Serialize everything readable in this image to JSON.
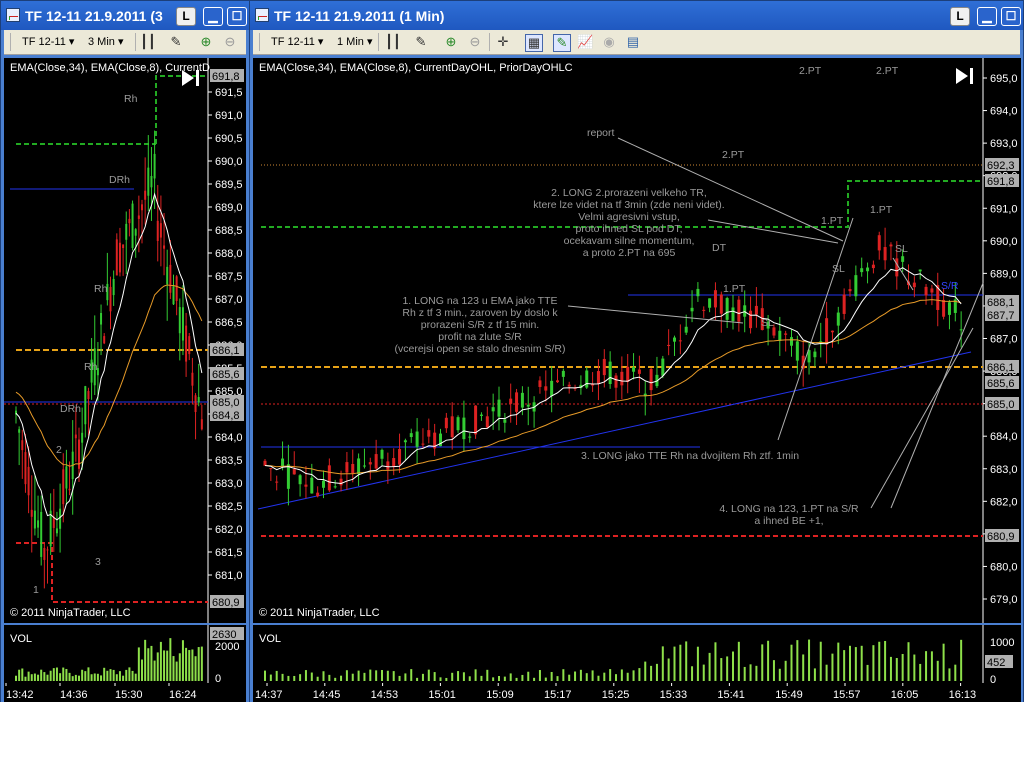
{
  "left_window": {
    "title": "TF 12-11  21.9.2011 (3",
    "indicator_btn": "L",
    "toolbar": {
      "instrument": "TF 12-11",
      "interval": "3 Min"
    },
    "indicators": "EMA(Close,34), EMA(Close,8), CurrentD",
    "copyright": "© 2011 NinjaTrader, LLC",
    "vol_label": "VOL",
    "price_axis": [
      "691,5",
      "691,0",
      "690,5",
      "690,0",
      "689,5",
      "689,0",
      "688,5",
      "688,0",
      "687,5",
      "687,0",
      "686,5",
      "686,0",
      "685,5",
      "685,0",
      "684,5",
      "684,0",
      "683,5",
      "683,0",
      "682,5",
      "682,0",
      "681,5",
      "681,0"
    ],
    "price_tags": [
      {
        "label": "691,8",
        "color": "#b0b0b0"
      },
      {
        "label": "686,1",
        "color": "#b0b0b0"
      },
      {
        "label": "685,6",
        "color": "#b0b0b0"
      },
      {
        "label": "685,0",
        "color": "#b0b0b0"
      },
      {
        "label": "684,8",
        "color": "#b0b0b0"
      },
      {
        "label": "680,9",
        "color": "#b0b0b0"
      }
    ],
    "vol_axis": [
      "2000",
      "0"
    ],
    "vol_tag": "2630",
    "time_axis": [
      "13:42",
      "14:36",
      "15:30",
      "16:24"
    ],
    "annotations": [
      "Rh",
      "DRh",
      "Rh",
      "Rh",
      "DRh",
      "2",
      "3",
      "1"
    ]
  },
  "right_window": {
    "title": "TF 12-11  21.9.2011 (1 Min)",
    "indicator_btn": "L",
    "toolbar": {
      "instrument": "TF 12-11",
      "interval": "1 Min"
    },
    "indicators": "EMA(Close,34), EMA(Close,8), CurrentDayOHL, PriorDayOHLC",
    "copyright": "© 2011 NinjaTrader, LLC",
    "vol_label": "VOL",
    "price_axis": [
      "695,0",
      "694,0",
      "693,0",
      "692,0",
      "691,0",
      "690,0",
      "689,0",
      "688,0",
      "687,0",
      "686,0",
      "685,0",
      "684,0",
      "683,0",
      "682,0",
      "681,0",
      "680,0",
      "679,0"
    ],
    "price_tags": [
      {
        "label": "692,3",
        "color": "#b0b0b0"
      },
      {
        "label": "691,8",
        "color": "#b0b0b0"
      },
      {
        "label": "688,1",
        "color": "#b0b0b0"
      },
      {
        "label": "687,7",
        "color": "#b0b0b0"
      },
      {
        "label": "686,1",
        "color": "#b0b0b0"
      },
      {
        "label": "685,6",
        "color": "#b0b0b0"
      },
      {
        "label": "685,0",
        "color": "#b0b0b0"
      },
      {
        "label": "680,9",
        "color": "#b0b0b0"
      }
    ],
    "vol_axis": [
      "1000",
      "500",
      "0"
    ],
    "vol_tag": "452",
    "time_axis": [
      "14:37",
      "14:45",
      "14:53",
      "15:01",
      "15:09",
      "15:17",
      "15:25",
      "15:33",
      "15:41",
      "15:49",
      "15:57",
      "16:05",
      "16:13"
    ],
    "annotations": {
      "report": "report",
      "pt2_top_a": "2.PT",
      "pt2_top_b": "2.PT",
      "pt2_mid": "2.PT",
      "pt1_a": "1.PT",
      "pt1_b": "1.PT",
      "pt1_c": "1.PT",
      "dt": "DT",
      "sl_a": "SL",
      "sl_b": "SL",
      "sl_c": "SL",
      "sr": "S/R",
      "note2": [
        "2. LONG 2.prorazeni velkeho TR,",
        "ktere lze videt na tf 3min (zde neni videt).",
        "Velmi agresivni vstup,",
        "proto ihned SL pod DT,",
        "ocekavam silne momentum,",
        "a proto 2.PT na 695"
      ],
      "note1": [
        "1. LONG na 123 u EMA jako TTE",
        "Rh z tf 3 min., zaroven by doslo k",
        "prorazeni S/R z tf 15 min.",
        "profit na zlute S/R",
        "(vcerejsi open se stalo dnesnim S/R)"
      ],
      "note3": "3. LONG jako TTE Rh na dvojitem Rh ztf. 1min",
      "note4": [
        "4. LONG na 123, 1.PT na S/R",
        "a ihned BE +1,"
      ]
    }
  },
  "colors": {
    "bg": "#000000",
    "green_dash": "#22aa22",
    "orange_dash": "#e8a317",
    "red_dash": "#dd2222",
    "blue_line": "#2233ee",
    "ema_fast": "#ffffff",
    "ema_slow": "#e69a28",
    "vol_bar": "#8ee04a"
  }
}
